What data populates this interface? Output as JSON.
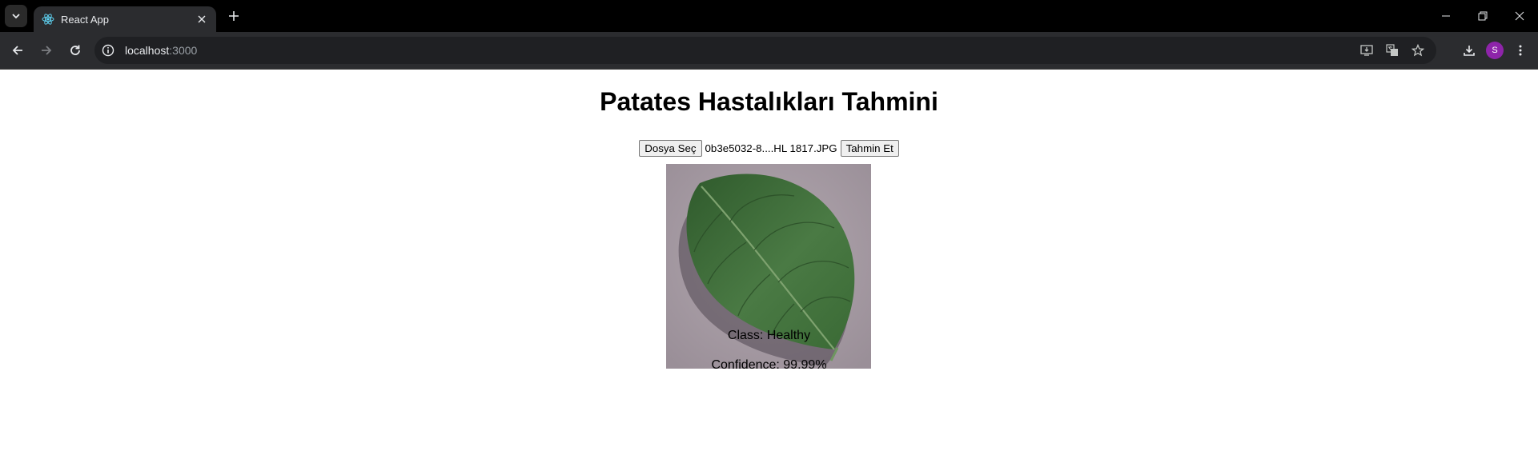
{
  "browser": {
    "tab_title": "React App",
    "url_host": "localhost",
    "url_port": ":3000",
    "avatar_initial": "S"
  },
  "page": {
    "heading": "Patates Hastalıkları Tahmini",
    "choose_file_label": "Dosya Seç",
    "file_name": "0b3e5032-8....HL 1817.JPG",
    "predict_label": "Tahmin Et",
    "class_text": "Class: Healthy",
    "confidence_text": "Confidence: 99.99%"
  },
  "colors": {
    "titlebar": "#000000",
    "toolbar": "#2b2c2f",
    "avatar": "#8e24aa",
    "leaf": "#3e6b3a",
    "leaf_background": "#a99ea6"
  }
}
